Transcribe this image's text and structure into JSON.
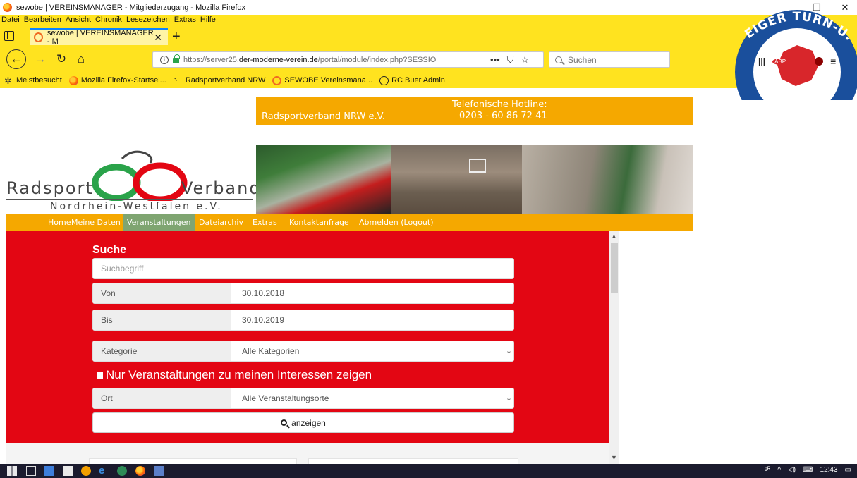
{
  "window": {
    "title": "sewobe | VEREINSMANAGER - Mitgliederzugang - Mozilla Firefox",
    "controls": [
      "–",
      "❐",
      "✕"
    ]
  },
  "menu": [
    "Datei",
    "Bearbeiten",
    "Ansicht",
    "Chronik",
    "Lesezeichen",
    "Extras",
    "Hilfe"
  ],
  "tab": {
    "label": "sewobe | VEREINSMANAGER - M",
    "close": "✕",
    "new": "+"
  },
  "nav": {
    "url_prefix": "https://server25.",
    "url_domain": "der-moderne-verein.de",
    "url_path": "/portal/module/index.php?SESSIO",
    "more": "•••",
    "search_placeholder": "Suchen"
  },
  "bookmarks": [
    {
      "label": "Meistbesucht",
      "icon": "gear-icon"
    },
    {
      "label": "Mozilla Firefox-Startsei...",
      "icon": "firefox-icon"
    },
    {
      "label": "Radsportverband NRW",
      "icon": "rss-icon"
    },
    {
      "label": "SEWOBE Vereinsmana...",
      "icon": "sewobe-icon"
    },
    {
      "label": "RC Buer Admin",
      "icon": "globe-icon"
    }
  ],
  "theme_badge": {
    "text": "BRAUNSCHWEIGER TURN-U. SPORTVEREIN",
    "visible_text": "EIGER TURN-U. S"
  },
  "header": {
    "org": "Radsportverband NRW e.V.",
    "hotline_label": "Telefonische Hotline:",
    "hotline_number": "0203 - 60 86 72 41"
  },
  "logo": {
    "word_left": "Radsport",
    "word_right": "Verband",
    "sub": "Nordrhein-Westfalen e.V."
  },
  "main_nav": [
    {
      "label": "Home",
      "active": false
    },
    {
      "label": "Meine Daten",
      "active": false
    },
    {
      "label": "Veranstaltungen",
      "active": true
    },
    {
      "label": "Dateiarchiv",
      "active": false
    },
    {
      "label": "Extras",
      "active": false
    },
    {
      "label": "Kontaktanfrage",
      "active": false
    },
    {
      "label": "Abmelden (Logout)",
      "active": false
    }
  ],
  "search": {
    "title": "Suche",
    "placeholder": "Suchbegriff",
    "von_label": "Von",
    "von_value": "30.10.2018",
    "bis_label": "Bis",
    "bis_value": "30.10.2019",
    "kategorie_label": "Kategorie",
    "kategorie_value": "Alle Kategorien",
    "interest_checkbox": "Nur Veranstaltungen zu meinen Interessen zeigen",
    "ort_label": "Ort",
    "ort_value": "Alle Veranstaltungsorte",
    "submit": "anzeigen"
  },
  "taskbar": {
    "time": "12:43"
  },
  "colors": {
    "firefox_theme": "#ffe31f",
    "brand_orange": "#f5a800",
    "active_nav": "#7fa571",
    "panel_red": "#e30613"
  }
}
